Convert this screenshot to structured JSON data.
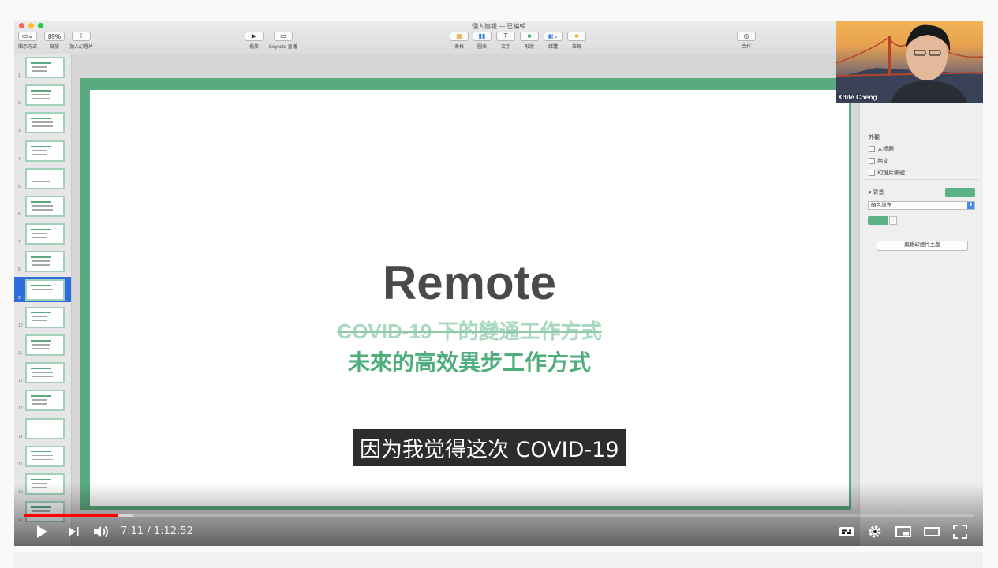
{
  "window": {
    "title": "個人簡報 — 已編輯"
  },
  "toolbar": {
    "view_label": "顯示方式",
    "zoom_value": "89%",
    "zoom_label": "縮放",
    "add_slide_label": "加入幻燈片",
    "play_label": "播放",
    "keynote_live_label": "Keynote 直播",
    "table_label": "表格",
    "chart_label": "圖表",
    "text_label": "文字",
    "shape_label": "形狀",
    "media_label": "媒體",
    "comment_label": "註解",
    "collaborate_label": "合作"
  },
  "navigator": {
    "slides": [
      "1",
      "2",
      "3",
      "4",
      "5",
      "6",
      "7",
      "8",
      "9",
      "10",
      "11",
      "12",
      "13",
      "14",
      "15",
      "16",
      "17"
    ],
    "selected": "9"
  },
  "slide": {
    "title": "Remote",
    "struck_line": "COVID-19 下的變通工作方式",
    "subtitle": "未來的高效異步工作方式"
  },
  "inspector": {
    "appearance_heading": "外觀",
    "title_option": "大標題",
    "body_option": "內文",
    "slide_number_option": "幻燈片編號",
    "background_heading": "背景",
    "fill_type": "顏色填充",
    "edit_master_button": "編輯幻燈片主版",
    "accent_color": "#5cb185"
  },
  "webcam": {
    "name": "Xdite Cheng"
  },
  "caption": {
    "text": "因为我觉得这次 COVID-19"
  },
  "player": {
    "time": "7:11 / 1:12:52",
    "progress": 0.0986,
    "buffered": 0.115,
    "progress_color": "#ff0000"
  }
}
